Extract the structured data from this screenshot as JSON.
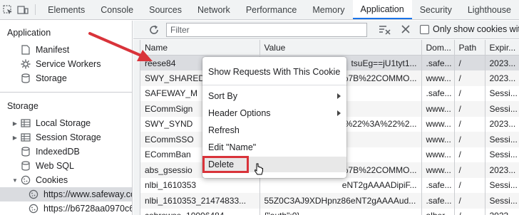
{
  "tabbar": {
    "tabs": [
      {
        "label": "Elements"
      },
      {
        "label": "Console"
      },
      {
        "label": "Sources"
      },
      {
        "label": "Network"
      },
      {
        "label": "Performance"
      },
      {
        "label": "Memory"
      },
      {
        "label": "Application",
        "active": true
      },
      {
        "label": "Security"
      },
      {
        "label": "Lighthouse"
      }
    ],
    "icons": [
      "inspect-element-icon",
      "device-toolbar-icon"
    ]
  },
  "sidebar": {
    "application_heading": "Application",
    "application_items": [
      {
        "label": "Manifest",
        "icon": "document-icon"
      },
      {
        "label": "Service Workers",
        "icon": "gear-icon"
      },
      {
        "label": "Storage",
        "icon": "database-icon"
      }
    ],
    "storage_heading": "Storage",
    "storage_items": [
      {
        "label": "Local Storage",
        "icon": "grid-icon",
        "expander": "▶"
      },
      {
        "label": "Session Storage",
        "icon": "grid-icon",
        "expander": "▶"
      },
      {
        "label": "IndexedDB",
        "icon": "database-icon"
      },
      {
        "label": "Web SQL",
        "icon": "database-icon"
      },
      {
        "label": "Cookies",
        "icon": "cookie-icon",
        "expander": "▼"
      },
      {
        "label": "https://www.safeway.co",
        "icon": "cookie-icon",
        "selected": true
      },
      {
        "label": "https://b6728aa0970c6",
        "icon": "cookie-icon"
      }
    ]
  },
  "toolbar": {
    "filter_placeholder": "Filter",
    "only_show_label": "Only show cookies with",
    "icons": [
      "refresh-icon",
      "clear-filter-icon",
      "close-icon"
    ]
  },
  "table": {
    "headers": [
      "Name",
      "Value",
      "Dom...",
      "Path",
      "Expir..."
    ],
    "rows": [
      [
        "reese84",
        "tsuEg==jU1tyt1...",
        ".safe...",
        "/",
        "2023..."
      ],
      [
        "SWY_SHARED",
        "%7B%22COMMO...",
        "www...",
        "/",
        "2023..."
      ],
      [
        "SAFEWAY_M",
        "",
        ".safe...",
        "/",
        "Sessi..."
      ],
      [
        "ECommSign",
        "",
        "www...",
        "/",
        "Sessi..."
      ],
      [
        "SWY_SYND",
        "%22%3A%22%2...",
        "www...",
        "/",
        "2023..."
      ],
      [
        "ECommSSO",
        "",
        "www...",
        "/",
        "Sessi..."
      ],
      [
        "ECommBan",
        "",
        "www...",
        "/",
        "Sessi..."
      ],
      [
        "abs_gsessio",
        "%7B%22COMMO...",
        "www...",
        "/",
        "2023..."
      ],
      [
        "nlbi_1610353",
        "eNT2gAAAADipiF...",
        ".safe...",
        "/",
        "Sessi..."
      ],
      [
        "nlbi_1610353_21474833...",
        "55Z0C3AJ9XDHpnz86eNT2gAAAAud...",
        ".safe...",
        "/",
        "Sessi..."
      ],
      [
        "cobrowse_10006484",
        "{\"auth\":0}",
        "alber...",
        "/",
        "2023..."
      ]
    ]
  },
  "context_menu": {
    "items": [
      {
        "label": "Show Requests With This Cookie"
      },
      {
        "label": "Sort By",
        "submenu": true
      },
      {
        "label": "Header Options",
        "submenu": true
      },
      {
        "label": "Refresh"
      },
      {
        "label": "Edit \"Name\""
      },
      {
        "label": "Delete",
        "highlighted": true
      }
    ]
  },
  "colors": {
    "accent": "#1a73e8",
    "annotation": "#d9333a"
  }
}
